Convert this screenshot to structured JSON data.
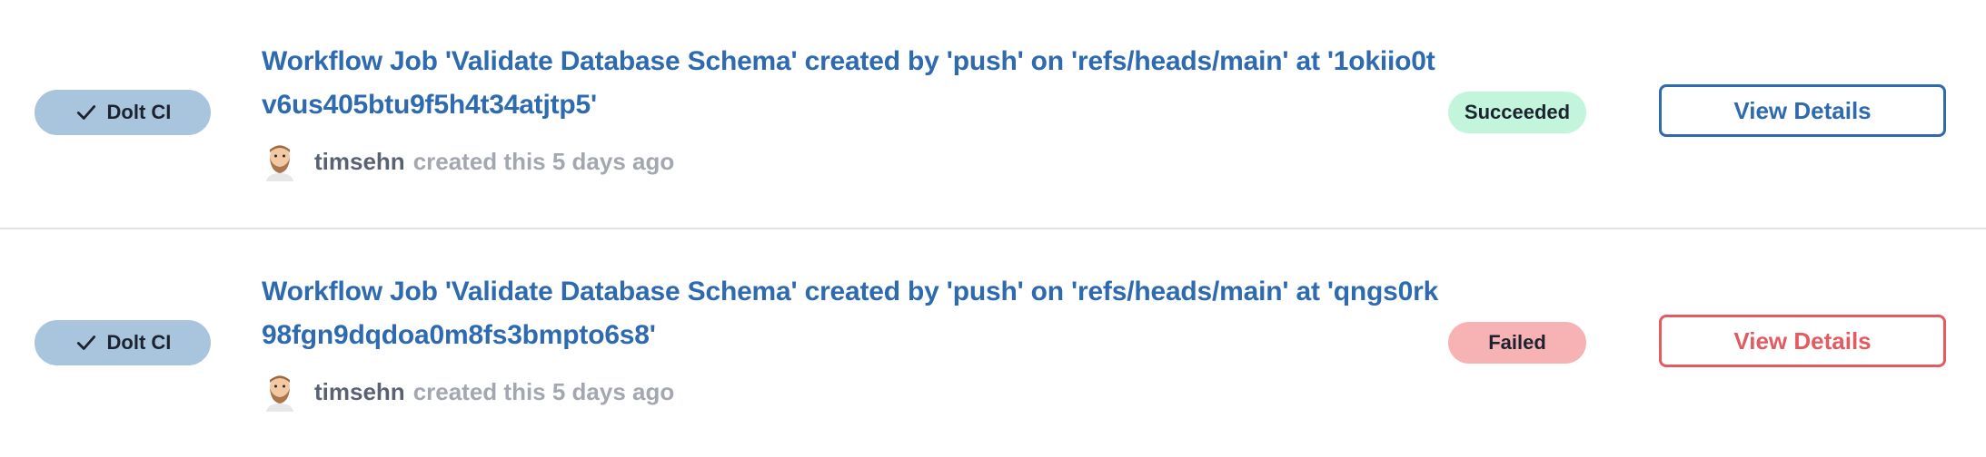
{
  "jobs": [
    {
      "badge_label": "Dolt CI",
      "title": "Workflow Job 'Validate Database Schema' created by 'push' on 'refs/heads/main' at '1okiio0tv6us405btu9f5h4t34atjtp5'",
      "author": "timsehn",
      "created_text": "created this 5 days ago",
      "status": "Succeeded",
      "status_color": "#c3f5dd",
      "details_label": "View Details",
      "details_color": "#2e6aaf"
    },
    {
      "badge_label": "Dolt CI",
      "title": "Workflow Job 'Validate Database Schema' created by 'push' on 'refs/heads/main' at 'qngs0rk98fgn9dqdoa0m8fs3bmpto6s8'",
      "author": "timsehn",
      "created_text": "created this 5 days ago",
      "status": "Failed",
      "status_color": "#f7b2b4",
      "details_label": "View Details",
      "details_color": "#e25b60"
    }
  ],
  "icons": {
    "badge_icon": "check-icon",
    "avatar_icon": "avatar"
  }
}
